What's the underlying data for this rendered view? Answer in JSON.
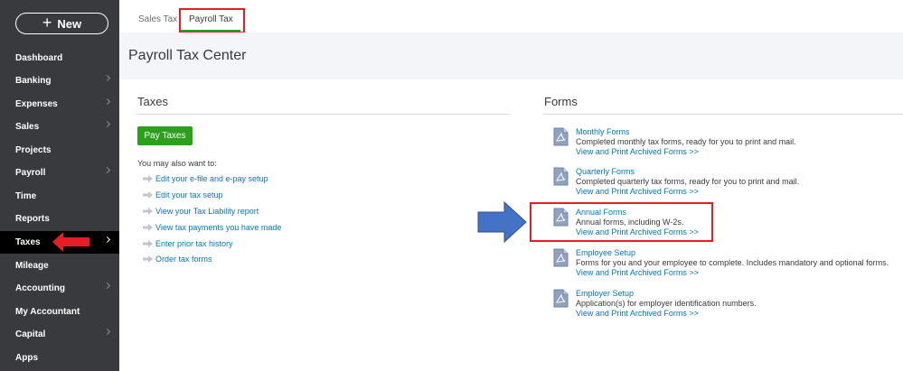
{
  "sidebar": {
    "new_label": "New",
    "items": [
      {
        "label": "Dashboard",
        "chevron": false
      },
      {
        "label": "Banking",
        "chevron": true
      },
      {
        "label": "Expenses",
        "chevron": true
      },
      {
        "label": "Sales",
        "chevron": true
      },
      {
        "label": "Projects",
        "chevron": false
      },
      {
        "label": "Payroll",
        "chevron": true
      },
      {
        "label": "Time",
        "chevron": false
      },
      {
        "label": "Reports",
        "chevron": false
      },
      {
        "label": "Taxes",
        "chevron": true,
        "active": true
      },
      {
        "label": "Mileage",
        "chevron": false
      },
      {
        "label": "Accounting",
        "chevron": true
      },
      {
        "label": "My Accountant",
        "chevron": false
      },
      {
        "label": "Capital",
        "chevron": true
      },
      {
        "label": "Apps",
        "chevron": false
      }
    ]
  },
  "tabs": {
    "sales_tax": "Sales Tax",
    "payroll_tax": "Payroll Tax"
  },
  "page_title": "Payroll Tax Center",
  "taxes": {
    "heading": "Taxes",
    "pay_button": "Pay Taxes",
    "also_text": "You may also want to:",
    "links": [
      "Edit your e-file and e-pay setup",
      "Edit your tax setup",
      "View your Tax Liability report",
      "View tax payments you have made",
      "Enter prior tax history",
      "Order tax forms"
    ]
  },
  "forms": {
    "heading": "Forms",
    "items": [
      {
        "title": "Monthly Forms",
        "desc": "Completed monthly tax forms, ready for you to print and mail.",
        "link": "View and Print Archived Forms >>"
      },
      {
        "title": "Quarterly Forms",
        "desc": "Completed quarterly tax forms, ready for you to print and mail.",
        "link": "View and Print Archived Forms >>"
      },
      {
        "title": "Annual Forms",
        "desc": "Annual forms, including W-2s.",
        "link": "View and Print Archived Forms >>"
      },
      {
        "title": "Employee Setup",
        "desc": "Forms for you and your employee to complete. Includes mandatory and optional forms.",
        "link": "View and Print Archived Forms >>"
      },
      {
        "title": "Employer Setup",
        "desc": "Application(s) for employer identification numbers.",
        "link": "View and Print Archived Forms >>"
      }
    ]
  },
  "colors": {
    "sidebar_bg": "#393a3d",
    "accent_green": "#2ca01c",
    "link_blue": "#0077c5",
    "highlight_red": "#e81c24",
    "annotation_blue": "#4472c4"
  }
}
